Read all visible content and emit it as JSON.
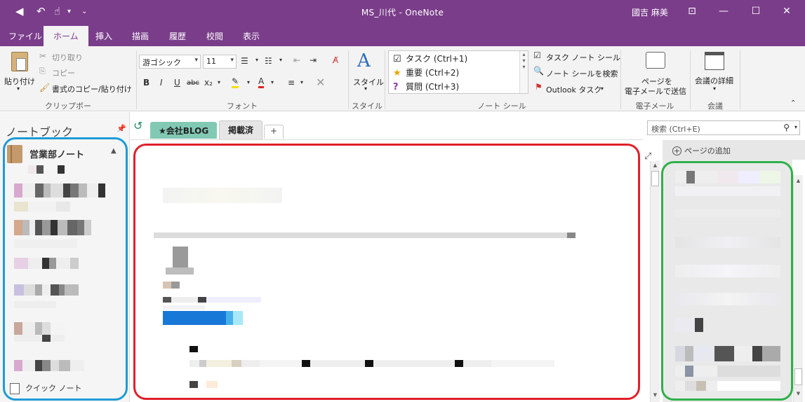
{
  "window": {
    "title": "MS_川代 - OneNote",
    "user": "國吉 麻美",
    "colors": {
      "brand": "#7a3d8a",
      "annot_blue": "#1e9bd7",
      "annot_red": "#e0202a",
      "annot_green": "#2fb04a"
    }
  },
  "ribbon_tabs": [
    "ファイル",
    "ホーム",
    "挿入",
    "描画",
    "履歴",
    "校閲",
    "表示"
  ],
  "ribbon": {
    "clipboard": {
      "paste": "貼り付け",
      "cut": "切り取り",
      "copy": "コピー",
      "format_painter": "書式のコピー/貼り付け",
      "label": "クリップボード"
    },
    "font": {
      "family": "游ゴシック",
      "size": "11",
      "label": "フォント"
    },
    "styles": {
      "button": "スタイル",
      "label": "スタイル"
    },
    "tags": {
      "items": [
        {
          "icon": "checkbox-icon",
          "text": "タスク (Ctrl+1)"
        },
        {
          "icon": "star-icon",
          "text": "重要 (Ctrl+2)"
        },
        {
          "icon": "question-icon",
          "text": "質問 (Ctrl+3)"
        }
      ],
      "todo_tag": "タスク ノート シール",
      "find_tags": "ノート シールを検索",
      "outlook_tasks": "Outlook タスク",
      "label": "ノート シール"
    },
    "email": {
      "line1": "ページを",
      "line2": "電子メールで送信",
      "label": "電子メール"
    },
    "meetings": {
      "button": "会議の詳細",
      "label": "会議"
    }
  },
  "notebook_pane": {
    "header": "ノートブック",
    "notebook_name": "営業部ノート",
    "quick_notes": "クイック ノート"
  },
  "section_tabs": [
    "★会社BLOG",
    "掲載済",
    "+"
  ],
  "search": {
    "placeholder": "検索 (Ctrl+E)"
  },
  "page_list": {
    "add_page": "ページの追加"
  }
}
